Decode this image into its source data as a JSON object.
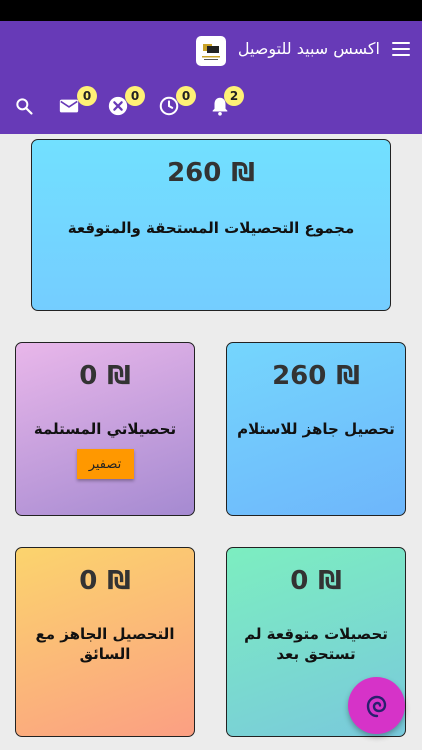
{
  "app": {
    "title": "اكسس سبيد للتوصيل",
    "logo_icon": "app-logo-icon"
  },
  "toolbar": {
    "messages_count": "0",
    "cancelled_count": "0",
    "pending_count": "0",
    "notifications_count": "2"
  },
  "cards": {
    "total": {
      "amount": "260",
      "currency": "₪",
      "label": "مجموع التحصيلات المستحقة والمتوقعة"
    },
    "ready": {
      "amount": "260",
      "currency": "₪",
      "label": "تحصيل جاهز للاستلام"
    },
    "received": {
      "amount": "0",
      "currency": "₪",
      "label": "تحصيلاتي المستلمة",
      "reset_label": "تصفير"
    },
    "expected": {
      "amount": "0",
      "currency": "₪",
      "label": "تحصيلات متوقعة لم تستحق بعد"
    },
    "driver": {
      "amount": "0",
      "currency": "₪",
      "label": "التحصيل الجاهز مع السائق"
    }
  },
  "colors": {
    "appbar": "#673ab7",
    "badge": "#fff176",
    "fab": "#d633c8",
    "reset_button": "#ff9800"
  }
}
